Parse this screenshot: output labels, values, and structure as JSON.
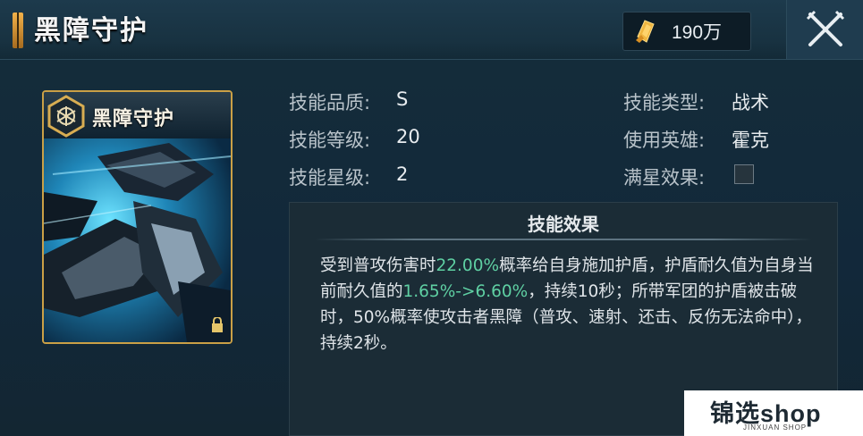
{
  "header": {
    "title": "黑障守护",
    "currency_value": "190万",
    "currency_icon": "gold-crystal-icon",
    "close_icon": "crossed-swords-close-icon"
  },
  "card": {
    "name": "黑障守护",
    "emblem_icon": "hexagon-tactic-icon",
    "art": "black-winged-mech-illustration",
    "lock_icon": "lock-icon"
  },
  "info": {
    "quality_label": "技能品质:",
    "quality_value": "S",
    "level_label": "技能等级:",
    "level_value": "20",
    "star_label": "技能星级:",
    "star_value": "2",
    "type_label": "技能类型:",
    "type_value": "战术",
    "hero_label": "使用英雄:",
    "hero_value": "霍克",
    "full_star_label": "满星效果:"
  },
  "effect": {
    "title": "技能效果",
    "t1": "受到普攻伤害时",
    "h1": "22.00%",
    "t2": "概率给自身施加护盾，护盾耐久值为自身当前耐久值的",
    "h2": "1.65%->6.60%",
    "t3": "，持续10秒；所带军团的护盾被击破时，50%概率使攻击者黑障（普攻、速射、还击、反伤无法命中），持续2秒。"
  },
  "watermark": {
    "text": "锦选shop",
    "sub": "JINXUAN SHOP"
  },
  "colors": {
    "highlight": "#5fd0a3",
    "card_border": "#caa046",
    "background": "#142835"
  }
}
